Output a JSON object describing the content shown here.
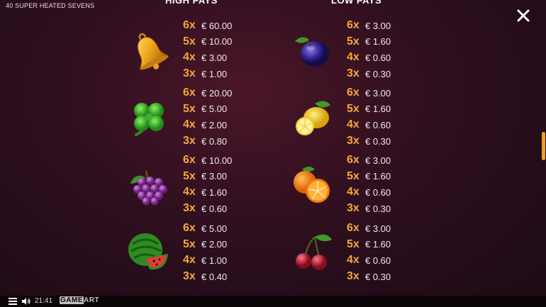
{
  "game_title": "40 SUPER HEATED SEVENS",
  "sections": {
    "high": {
      "title": "HIGH PAYS"
    },
    "low": {
      "title": "LOW PAYS"
    }
  },
  "colors": {
    "multiplier": "#f2a93b",
    "accent_scroll": "#f0a020",
    "background": "#2e0f1f"
  },
  "paytable": {
    "high": [
      {
        "icon": "bell-icon",
        "pays": [
          {
            "mult": "6x",
            "value": "€ 60.00"
          },
          {
            "mult": "5x",
            "value": "€ 10.00"
          },
          {
            "mult": "4x",
            "value": "€ 3.00"
          },
          {
            "mult": "3x",
            "value": "€ 1.00"
          }
        ]
      },
      {
        "icon": "clover-icon",
        "pays": [
          {
            "mult": "6x",
            "value": "€ 20.00"
          },
          {
            "mult": "5x",
            "value": "€ 5.00"
          },
          {
            "mult": "4x",
            "value": "€ 2.00"
          },
          {
            "mult": "3x",
            "value": "€ 0.80"
          }
        ]
      },
      {
        "icon": "grapes-icon",
        "pays": [
          {
            "mult": "6x",
            "value": "€ 10.00"
          },
          {
            "mult": "5x",
            "value": "€ 3.00"
          },
          {
            "mult": "4x",
            "value": "€ 1.60"
          },
          {
            "mult": "3x",
            "value": "€ 0.60"
          }
        ]
      },
      {
        "icon": "watermelon-icon",
        "pays": [
          {
            "mult": "6x",
            "value": "€ 5.00"
          },
          {
            "mult": "5x",
            "value": "€ 2.00"
          },
          {
            "mult": "4x",
            "value": "€ 1.00"
          },
          {
            "mult": "3x",
            "value": "€ 0.40"
          }
        ]
      }
    ],
    "low": [
      {
        "icon": "plum-icon",
        "pays": [
          {
            "mult": "6x",
            "value": "€ 3.00"
          },
          {
            "mult": "5x",
            "value": "€ 1.60"
          },
          {
            "mult": "4x",
            "value": "€ 0.60"
          },
          {
            "mult": "3x",
            "value": "€ 0.30"
          }
        ]
      },
      {
        "icon": "lemon-icon",
        "pays": [
          {
            "mult": "6x",
            "value": "€ 3.00"
          },
          {
            "mult": "5x",
            "value": "€ 1.60"
          },
          {
            "mult": "4x",
            "value": "€ 0.60"
          },
          {
            "mult": "3x",
            "value": "€ 0.30"
          }
        ]
      },
      {
        "icon": "orange-icon",
        "pays": [
          {
            "mult": "6x",
            "value": "€ 3.00"
          },
          {
            "mult": "5x",
            "value": "€ 1.60"
          },
          {
            "mult": "4x",
            "value": "€ 0.60"
          },
          {
            "mult": "3x",
            "value": "€ 0.30"
          }
        ]
      },
      {
        "icon": "cherry-icon",
        "pays": [
          {
            "mult": "6x",
            "value": "€ 3.00"
          },
          {
            "mult": "5x",
            "value": "€ 1.60"
          },
          {
            "mult": "4x",
            "value": "€ 0.60"
          },
          {
            "mult": "3x",
            "value": "€ 0.30"
          }
        ]
      }
    ]
  },
  "footer": {
    "time": "21:41",
    "logo_game": "GAME",
    "logo_art": "ART",
    "menu_icon": "hamburger-menu-icon",
    "sound_icon": "speaker-icon"
  },
  "close_icon": "close-icon"
}
